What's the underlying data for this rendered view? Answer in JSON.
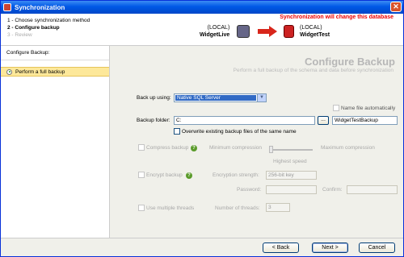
{
  "window": {
    "title": "Synchronization",
    "close_label": "✕"
  },
  "steps": [
    {
      "label": "1 - Choose synchronization method"
    },
    {
      "label": "2 - Configure backup"
    },
    {
      "label": "3 - Review"
    }
  ],
  "header": {
    "warning": "Synchronization will change this database",
    "source": {
      "server": "(LOCAL)",
      "database": "WidgetLive"
    },
    "target": {
      "server": "(LOCAL)",
      "database": "WidgetTest"
    }
  },
  "sidebar": {
    "heading": "Configure Backup:",
    "items": [
      {
        "label": "Perform a full backup"
      }
    ]
  },
  "content": {
    "title": "Configure Backup",
    "subtitle": "Perform a full backup of the schema and data before synchronization",
    "backup_using_label": "Back up using:",
    "backup_using_value": "Native SQL Server",
    "name_auto_label": "Name file automatically",
    "backup_folder_label": "Backup folder:",
    "backup_folder_value": "C:",
    "browse_label": "...",
    "file_name_value": "WidgetTestBackup",
    "overwrite_label": "Overwrite existing backup files of the same name",
    "compress_label": "Compress backup",
    "min_compression": "Minimum compression",
    "max_compression": "Maximum compression",
    "speed_label": "Highest speed",
    "encrypt_label": "Encrypt backup",
    "encryption_strength_label": "Encryption strength:",
    "encryption_strength_value": "256-bit key",
    "password_label": "Password:",
    "confirm_label": "Confirm:",
    "threads_label": "Use multiple threads",
    "num_threads_label": "Number of threads:",
    "num_threads_value": "3"
  },
  "footer": {
    "back": "< Back",
    "next": "Next >",
    "cancel": "Cancel"
  },
  "icons": {
    "close": "close-icon",
    "help": "help-icon",
    "arrow": "right-arrow-icon",
    "source_db": "database-server-icon",
    "target_db": "database-icon"
  },
  "colors": {
    "titlebar": "#0058e6",
    "warning": "#e00000",
    "selected_item": "#fde89a"
  }
}
